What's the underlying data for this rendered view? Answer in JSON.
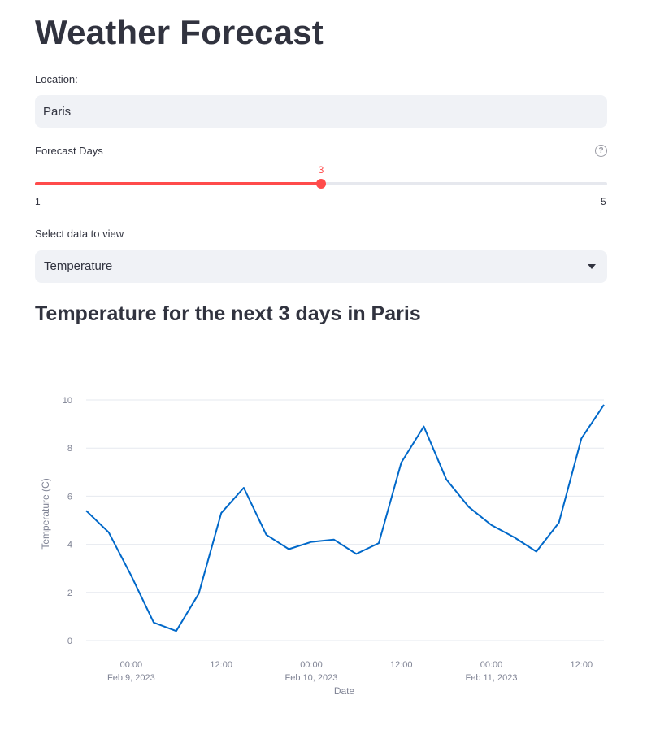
{
  "app": {
    "title": "Weather Forecast"
  },
  "location": {
    "label": "Location:",
    "value": "Paris"
  },
  "forecast_days": {
    "label": "Forecast Days",
    "help_icon": "question-circle-icon",
    "value": 3,
    "min": 1,
    "max": 5,
    "value_text": "3",
    "min_text": "1",
    "max_text": "5"
  },
  "data_select": {
    "label": "Select data to view",
    "selected": "Temperature",
    "icon": "chevron-down-icon"
  },
  "section": {
    "title": "Temperature for the next 3 days in Paris"
  },
  "colors": {
    "accent": "#ff4b4b",
    "line": "#0068c9",
    "input_bg": "#f0f2f6",
    "text": "#31333f"
  },
  "chart_data": {
    "type": "line",
    "title": "",
    "xlabel": "Date",
    "ylabel": "Temperature (C)",
    "ylim": [
      0,
      10
    ],
    "xlim": [
      "2023-02-08T18:00",
      "2023-02-11T15:00"
    ],
    "yticks": [
      0,
      2,
      4,
      6,
      8,
      10
    ],
    "xticks": [
      {
        "at": "2023-02-09T00:00",
        "time": "00:00",
        "date": "Feb 9, 2023"
      },
      {
        "at": "2023-02-09T12:00",
        "time": "12:00",
        "date": ""
      },
      {
        "at": "2023-02-10T00:00",
        "time": "00:00",
        "date": "Feb 10, 2023"
      },
      {
        "at": "2023-02-10T12:00",
        "time": "12:00",
        "date": ""
      },
      {
        "at": "2023-02-11T00:00",
        "time": "00:00",
        "date": "Feb 11, 2023"
      },
      {
        "at": "2023-02-11T12:00",
        "time": "12:00",
        "date": ""
      }
    ],
    "grid": true,
    "series": [
      {
        "x": [
          "2023-02-08T18:00",
          "2023-02-08T21:00",
          "2023-02-09T00:00",
          "2023-02-09T03:00",
          "2023-02-09T06:00",
          "2023-02-09T09:00",
          "2023-02-09T12:00",
          "2023-02-09T15:00",
          "2023-02-09T18:00",
          "2023-02-09T21:00",
          "2023-02-10T00:00",
          "2023-02-10T03:00",
          "2023-02-10T06:00",
          "2023-02-10T09:00",
          "2023-02-10T12:00",
          "2023-02-10T15:00",
          "2023-02-10T18:00",
          "2023-02-10T21:00",
          "2023-02-11T00:00",
          "2023-02-11T03:00",
          "2023-02-11T06:00",
          "2023-02-11T09:00",
          "2023-02-11T12:00",
          "2023-02-11T15:00"
        ],
        "values": [
          5.4,
          4.5,
          2.7,
          0.75,
          0.4,
          1.95,
          5.3,
          6.35,
          4.4,
          3.8,
          4.1,
          4.2,
          3.6,
          4.05,
          7.4,
          8.9,
          6.7,
          5.55,
          4.8,
          4.3,
          3.7,
          4.9,
          8.4,
          9.8
        ]
      }
    ]
  }
}
